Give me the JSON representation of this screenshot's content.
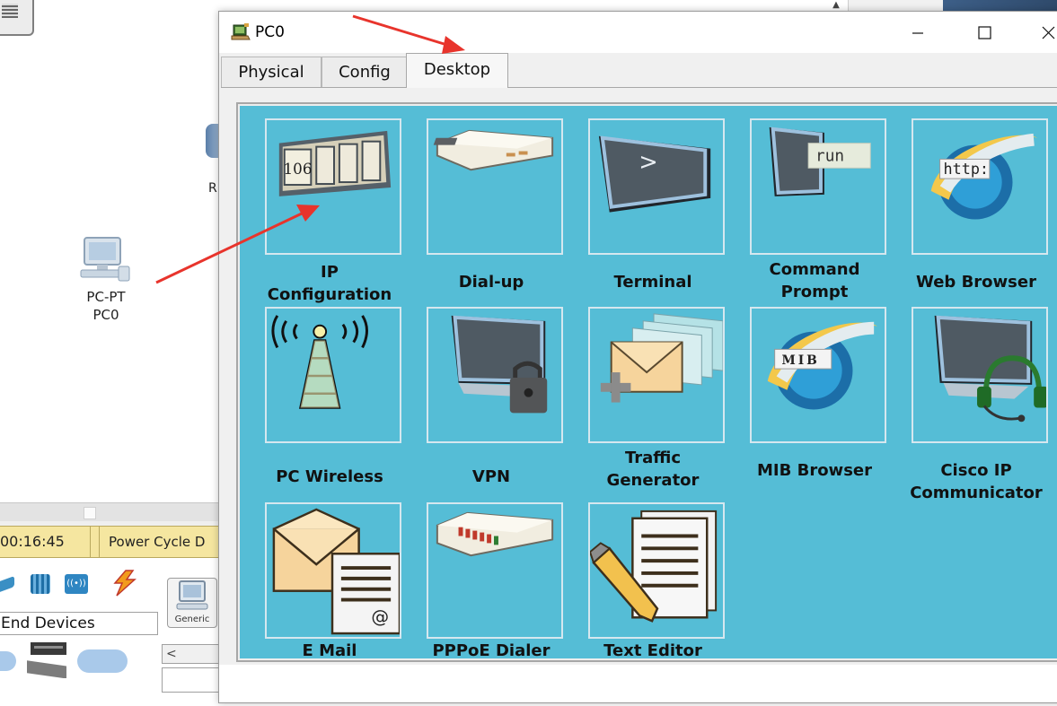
{
  "background_app": {
    "router_label": "R",
    "pc_label_line1": "PC-PT",
    "pc_label_line2": "PC0",
    "timer": "00:16:45",
    "power_cycle": "Power Cycle D",
    "category_label": "End Devices",
    "generic_label": "Generic",
    "scroll_left": "<"
  },
  "window": {
    "title": "PC0",
    "minimize": "minimize",
    "maximize": "maximize",
    "close": "close",
    "tabs": [
      {
        "label": "Physical",
        "active": false
      },
      {
        "label": "Config",
        "active": false
      },
      {
        "label": "Desktop",
        "active": true
      }
    ]
  },
  "apps": [
    {
      "id": "ip-configuration",
      "lines": [
        "IP",
        "Configuration"
      ],
      "icon": "ip-configuration-icon",
      "icon_text": "106"
    },
    {
      "id": "dial-up",
      "lines": [
        "Dial-up"
      ],
      "icon": "modem-icon"
    },
    {
      "id": "terminal",
      "lines": [
        "Terminal"
      ],
      "icon": "terminal-icon",
      "icon_text": ">"
    },
    {
      "id": "command-prompt",
      "lines": [
        "Command",
        "Prompt"
      ],
      "icon": "command-prompt-icon",
      "icon_text": "run"
    },
    {
      "id": "web-browser",
      "lines": [
        "Web Browser"
      ],
      "icon": "web-browser-icon",
      "icon_text": "http:"
    },
    {
      "id": "pc-wireless",
      "lines": [
        "PC Wireless"
      ],
      "icon": "wireless-tower-icon"
    },
    {
      "id": "vpn",
      "lines": [
        "VPN"
      ],
      "icon": "vpn-lock-icon"
    },
    {
      "id": "traffic-generator",
      "lines": [
        "Traffic",
        "Generator"
      ],
      "icon": "traffic-generator-icon"
    },
    {
      "id": "mib-browser",
      "lines": [
        "MIB Browser"
      ],
      "icon": "mib-browser-icon",
      "icon_text": "MIB"
    },
    {
      "id": "cisco-ip-communicator",
      "lines": [
        "Cisco IP",
        "Communicator"
      ],
      "icon": "headset-monitor-icon"
    },
    {
      "id": "email",
      "lines": [
        "E Mail"
      ],
      "icon": "email-icon"
    },
    {
      "id": "pppoe-dialer",
      "lines": [
        "PPPoE Dialer"
      ],
      "icon": "pppoe-router-icon"
    },
    {
      "id": "text-editor",
      "lines": [
        "Text Editor"
      ],
      "icon": "text-editor-icon"
    }
  ],
  "colors": {
    "desktop_bg": "#55bdd6",
    "annotation_red": "#e8342c",
    "tile_border": "#d5e7ef"
  }
}
